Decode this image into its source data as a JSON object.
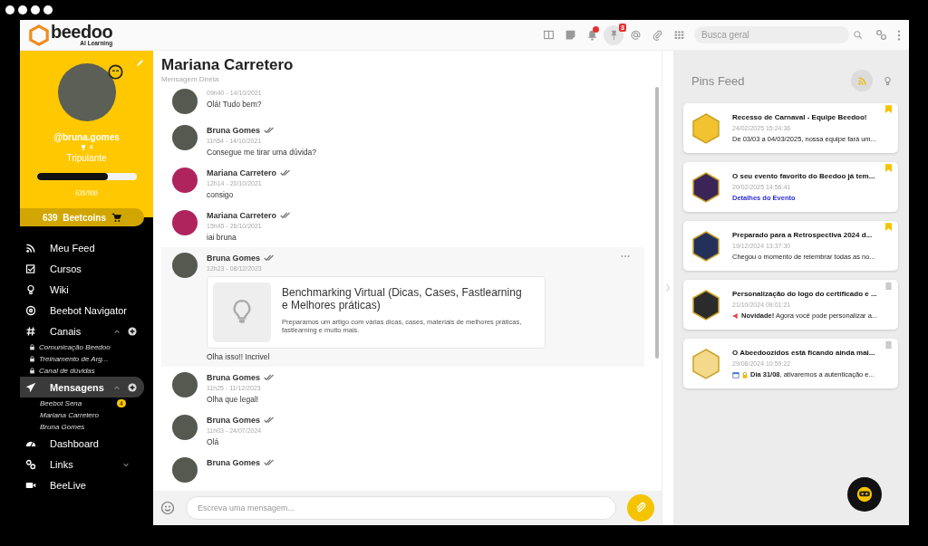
{
  "header": {
    "logo": {
      "name": "beedoo",
      "tagline": "AI Learning"
    },
    "tools": [
      {
        "kind": "panels",
        "active": false,
        "dot": false
      },
      {
        "kind": "note",
        "active": false,
        "dot": false
      },
      {
        "kind": "bell",
        "active": false,
        "dot": true
      },
      {
        "kind": "pin",
        "active": true,
        "dot": false,
        "badge": "3"
      },
      {
        "kind": "mention",
        "active": false,
        "dot": false
      },
      {
        "kind": "clip",
        "active": false,
        "dot": false
      },
      {
        "kind": "grid",
        "active": false,
        "dot": false
      }
    ],
    "search": {
      "placeholder": "Busca geral"
    }
  },
  "profile": {
    "username": "@bruna.gomes",
    "trophies": "4",
    "rank": "Tripulante",
    "level": 0.71,
    "points": "639/900",
    "coins": "639",
    "coins_label": "Beetcoins"
  },
  "nav": [
    {
      "kind": "rss",
      "label": "Meu Feed",
      "selected": false
    },
    {
      "kind": "check",
      "label": "Cursos",
      "selected": false
    },
    {
      "kind": "bulb",
      "label": "Wiki",
      "selected": false
    },
    {
      "kind": "compass",
      "label": "Beebot Navigator",
      "selected": false
    },
    {
      "kind": "hash",
      "label": "Canais",
      "selected": false,
      "expanded": true,
      "add": true,
      "children": [
        {
          "kind": "channel",
          "label": "Comunicação Beedoo"
        },
        {
          "kind": "channel",
          "label": "Treinamento de Arg..."
        },
        {
          "kind": "channel",
          "label": "Canal de dúvidas"
        }
      ]
    },
    {
      "kind": "send",
      "label": "Mensagens",
      "selected": true,
      "expanded": true,
      "add": true,
      "children": [
        {
          "kind": "contact",
          "label": "Beebot Sena",
          "badge": "4"
        },
        {
          "kind": "contact",
          "label": "Mariana Carretero"
        },
        {
          "kind": "contact",
          "label": "Bruna Gomes"
        }
      ]
    },
    {
      "kind": "dashboard",
      "label": "Dashboard",
      "selected": false
    },
    {
      "kind": "link",
      "label": "Links",
      "selected": false,
      "expanded": false
    },
    {
      "kind": "video",
      "label": "BeeLive",
      "selected": false
    }
  ],
  "chat": {
    "title": "Mariana Carretero",
    "subtitle": "Mensagem Direta",
    "messages": [
      {
        "kind": "photo",
        "time": "09h40 - 14/10/2021",
        "text": "Olá! Tudo bem?",
        "highlighted": false
      },
      {
        "kind": "photo",
        "author": "Bruna Gomes",
        "read": true,
        "time": "11h54 - 14/10/2021",
        "text": "Consegue me tirar uma dúvida?",
        "highlighted": false
      },
      {
        "kind": "cartoon",
        "author": "Mariana Carretero",
        "read": true,
        "time": "12h14 - 20/10/2021",
        "text": "consigo",
        "highlighted": false
      },
      {
        "kind": "cartoon",
        "author": "Mariana Carretero",
        "read": true,
        "time": "15h45 - 26/10/2021",
        "text": "iai bruna",
        "highlighted": false
      },
      {
        "kind": "photo",
        "author": "Bruna Gomes",
        "read": true,
        "time": "12h23 - 08/12/2023",
        "text": "Olha isso!! Incrivel",
        "highlighted": true,
        "card": {
          "title": "Benchmarking Virtual (Dicas, Cases, Fastlearning e Melhores práticas)",
          "description": "Preparamos um artigo com várias dicas, cases, materiais de melhores práticas, fastlearning e muito mais."
        }
      },
      {
        "kind": "photo",
        "author": "Bruna Gomes",
        "read": true,
        "time": "11h25 - 11/12/2023",
        "text": "Olha que legal!",
        "highlighted": false
      },
      {
        "kind": "photo",
        "author": "Bruna Gomes",
        "read": true,
        "time": "11h03 - 24/07/2024",
        "text": "Olá",
        "highlighted": false
      },
      {
        "kind": "photo",
        "author": "Bruna Gomes",
        "read": true,
        "highlighted": false
      }
    ],
    "composer": {
      "placeholder": "Escreva uma mensagem..."
    }
  },
  "pins": {
    "title": "Pins Feed",
    "views": [
      {
        "kind": "rss",
        "selected": true
      },
      {
        "kind": "bulb",
        "selected": false
      }
    ],
    "items": [
      {
        "color": "#f2c230",
        "title": "Recesso de Carnaval - Equipe Beedoo!",
        "date": "24/02/2025 15:24:36",
        "kind": "text",
        "body": "De 03/03 a 04/03/2025, nossa equipe fará um...",
        "pinned": true
      },
      {
        "color": "#3b2458",
        "title": "O seu evento favorito do Beedoo já tem...",
        "date": "20/02/2025 14:56:41",
        "kind": "link",
        "body": "Detalhes do Evento",
        "pinned": true
      },
      {
        "color": "#23305a",
        "title": "Preparado para a Retrospectiva 2024 d...",
        "date": "19/12/2024 13:37:30",
        "kind": "text",
        "body": "Chegou o momento de relembrar todas as no...",
        "pinned": true
      },
      {
        "color": "#2b2b2b",
        "title": "Personalização do logo do certificado e ...",
        "date": "21/10/2024 09:01:21",
        "kind": "megaphone",
        "body": "**Novidade!** Agora você pode personalizar a...",
        "pinned": false
      },
      {
        "color": "#f5d98a",
        "title": "O Abeedoozidos está ficando ainda mai...",
        "date": "29/08/2024 10:59:22",
        "kind": "calendar",
        "body": "**Dia 31/08**, ativaremos a autenticação e...",
        "pinned": false
      }
    ]
  }
}
